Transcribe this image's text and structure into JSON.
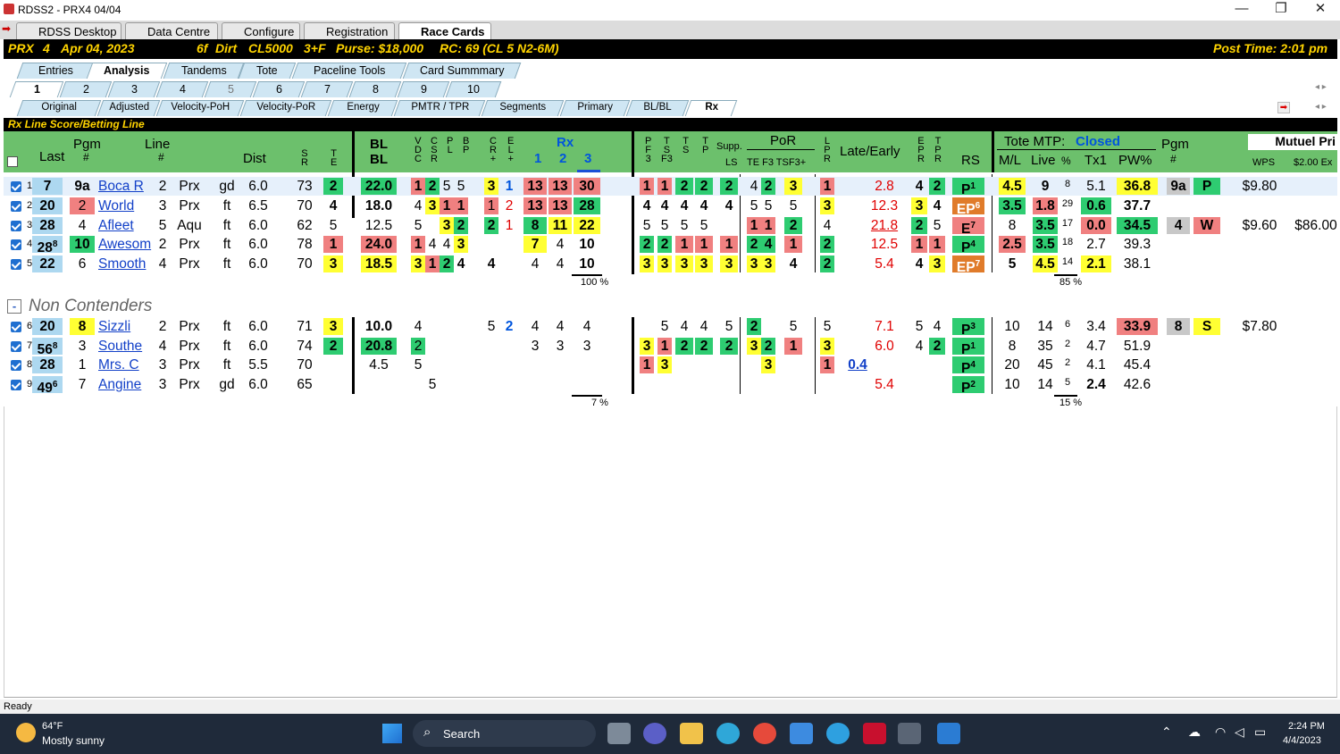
{
  "window": {
    "title": "RDSS2 - PRX4  04/04"
  },
  "app_tabs": [
    "RDSS Desktop",
    "Data Centre",
    "Configure",
    "Registration",
    "Race Cards"
  ],
  "race": {
    "track": "PRX",
    "race": "4",
    "date": "Apr 04, 2023",
    "distance": "6f",
    "surface": "Dirt",
    "class": "CL5000",
    "age": "3+F",
    "purse": "Purse: $18,000",
    "rc": "RC: 69 (CL 5 N2-6M)",
    "post_time": "Post Time: 2:01 pm"
  },
  "view_tabs": [
    "Entries",
    "Analysis",
    "Tandems",
    "Tote",
    "Paceline Tools",
    "Card Summmary"
  ],
  "race_tabs": [
    "1",
    "2",
    "3",
    "4",
    "5",
    "6",
    "7",
    "8",
    "9",
    "10"
  ],
  "sub_tabs": [
    "Original",
    "Adjusted",
    "Velocity-PoH",
    "Velocity-PoR",
    "Energy",
    "PMTR / TPR",
    "Segments",
    "Primary",
    "BL/BL",
    "Rx"
  ],
  "section_title": "Rx Line Score/Betting Line",
  "headers": {
    "last": "Last",
    "pgm": "Pgm",
    "pgm_hash": "#",
    "line": "Line",
    "line_hash": "#",
    "dist": "Dist",
    "sr": [
      "S",
      "R"
    ],
    "te": [
      "T",
      "E"
    ],
    "bl1": "BL",
    "bl2": "BL",
    "vdc": [
      "V",
      "D",
      "C"
    ],
    "csr": [
      "C",
      "S",
      "R"
    ],
    "pl": [
      "P",
      "L"
    ],
    "bp": [
      "B",
      "P"
    ],
    "cr": [
      "C",
      "R",
      "+"
    ],
    "el": [
      "E",
      "L",
      "+"
    ],
    "rx": "Rx",
    "rx_cols": [
      "1",
      "2",
      "3"
    ],
    "pf3": [
      "P",
      "F",
      "3"
    ],
    "tsf3": [
      "T",
      "S",
      "F3"
    ],
    "ts": [
      "T",
      "S"
    ],
    "tp": [
      "T",
      "P"
    ],
    "supp": "Supp.",
    "ls": "LS",
    "por": "PoR",
    "por_cols": "TE F3 TSF3+",
    "lpr": [
      "L",
      "P",
      "R"
    ],
    "late_early": "Late/Early",
    "epr": [
      "E",
      "P",
      "R"
    ],
    "tpr": [
      "T",
      "P",
      "R"
    ],
    "rs": "RS",
    "tote": "Tote MTP:",
    "tote_status": "Closed",
    "ml": "M/L",
    "live": "Live",
    "pct": "%",
    "tx1": "Tx1",
    "pw": "PW%",
    "pgm2": "Pgm",
    "pgm2_hash": "#",
    "mutuel": "Mutuel Pri",
    "wps": "WPS",
    "ex": "$2.00 Ex"
  },
  "contenders": [
    {
      "n": "1",
      "last": "7",
      "pgm": "9a",
      "name": "Boca R",
      "line": "2",
      "trk": "Prx",
      "cond": "gd",
      "dist": "6.0",
      "sr": "73",
      "te": "2",
      "bl": "22.0",
      "vdc": "1",
      "csr": "2",
      "pl": "5",
      "bp": "5",
      "cr": "3",
      "el": "1",
      "rx1": "13",
      "rx2": "13",
      "rx3": "30",
      "p3": "1",
      "tsf3": "1",
      "ts": "2",
      "tp": "2",
      "supp": "2",
      "te2": "4",
      "f3": "2",
      "tsf3p": "3",
      "lpr": "1",
      "late": "2.8",
      "epr": "4",
      "tpr": "2",
      "rs": "P",
      "rs_sup": "1",
      "ml": "4.5",
      "live": "9",
      "pct": "8",
      "tx1": "5.1",
      "pw": "36.8",
      "pgm2": "9a",
      "pos": "P",
      "wps": "$9.80",
      "ex": ""
    },
    {
      "n": "2",
      "last": "20",
      "pgm": "2",
      "name": "World",
      "line": "3",
      "trk": "Prx",
      "cond": "ft",
      "dist": "6.5",
      "sr": "70",
      "te": "4",
      "bl": "18.0",
      "vdc": "4",
      "csr": "3",
      "pl": "1",
      "bp": "1",
      "cr": "1",
      "el": "2",
      "rx1": "13",
      "rx2": "13",
      "rx3": "28",
      "p3": "4",
      "tsf3": "4",
      "ts": "4",
      "tp": "4",
      "supp": "4",
      "te2": "5",
      "f3": "5",
      "tsf3p": "5",
      "lpr": "3",
      "late": "12.3",
      "epr": "3",
      "tpr": "4",
      "rs": "EP",
      "rs_sup": "6",
      "ml": "3.5",
      "live": "1.8",
      "pct": "29",
      "tx1": "0.6",
      "pw": "37.7",
      "pgm2": "",
      "pos": "",
      "wps": "",
      "ex": ""
    },
    {
      "n": "3",
      "last": "28",
      "pgm": "4",
      "name": "Afleet",
      "line": "5",
      "trk": "Aqu",
      "cond": "ft",
      "dist": "6.0",
      "sr": "62",
      "te": "5",
      "bl": "12.5",
      "vdc": "5",
      "csr": "",
      "pl": "3",
      "bp": "2",
      "cr": "2",
      "el": "1",
      "rx1": "8",
      "rx2": "11",
      "rx3": "22",
      "p3": "5",
      "tsf3": "5",
      "ts": "5",
      "tp": "5",
      "supp": "",
      "te2": "1",
      "f3": "1",
      "tsf3p": "2",
      "lpr": "4",
      "late": "21.8",
      "epr": "2",
      "tpr": "5",
      "rs": "E",
      "rs_sup": "7",
      "ml": "8",
      "live": "3.5",
      "pct": "17",
      "tx1": "0.0",
      "pw": "34.5",
      "pgm2": "4",
      "pos": "W",
      "wps": "$9.60",
      "ex": "$86.00"
    },
    {
      "n": "4",
      "last": "28",
      "last_sup": "8",
      "pgm": "10",
      "name": "Awesom",
      "line": "2",
      "trk": "Prx",
      "cond": "ft",
      "dist": "6.0",
      "sr": "78",
      "te": "1",
      "bl": "24.0",
      "vdc": "1",
      "csr": "4",
      "pl": "4",
      "bp": "3",
      "cr": "",
      "el": "",
      "rx1": "7",
      "rx2": "4",
      "rx3": "10",
      "p3": "2",
      "tsf3": "2",
      "ts": "1",
      "tp": "1",
      "supp": "1",
      "te2": "2",
      "f3": "4",
      "tsf3p": "1",
      "lpr": "2",
      "late": "12.5",
      "epr": "1",
      "tpr": "1",
      "rs": "P",
      "rs_sup": "4",
      "ml": "2.5",
      "live": "3.5",
      "pct": "18",
      "tx1": "2.7",
      "pw": "39.3",
      "pgm2": "",
      "pos": "",
      "wps": "",
      "ex": ""
    },
    {
      "n": "5",
      "last": "22",
      "pgm": "6",
      "name": "Smooth",
      "line": "4",
      "trk": "Prx",
      "cond": "ft",
      "dist": "6.0",
      "sr": "70",
      "te": "3",
      "bl": "18.5",
      "vdc": "3",
      "csr": "1",
      "pl": "2",
      "bp": "4",
      "cr": "4",
      "el": "",
      "rx1": "4",
      "rx2": "4",
      "rx3": "10",
      "p3": "3",
      "tsf3": "3",
      "ts": "3",
      "tp": "3",
      "supp": "3",
      "te2": "3",
      "f3": "3",
      "tsf3p": "4",
      "lpr": "2",
      "late": "5.4",
      "epr": "4",
      "tpr": "3",
      "rs": "EP",
      "rs_sup": "7",
      "ml": "5",
      "live": "4.5",
      "pct": "14",
      "tx1": "2.1",
      "pw": "38.1",
      "pgm2": "",
      "pos": "",
      "wps": "",
      "ex": ""
    }
  ],
  "contender_pct": {
    "rx": "100 %",
    "live": "85 %"
  },
  "non_contenders_label": "Non Contenders",
  "non_contenders": [
    {
      "n": "6",
      "last": "20",
      "pgm": "8",
      "name": "Sizzli",
      "line": "2",
      "trk": "Prx",
      "cond": "ft",
      "dist": "6.0",
      "sr": "71",
      "te": "3",
      "bl": "10.0",
      "vdc": "4",
      "cr": "5",
      "el": "2",
      "rx1": "4",
      "rx2": "4",
      "rx3": "4",
      "tsf3": "5",
      "ts": "4",
      "tp": "4",
      "supp": "5",
      "te2": "2",
      "tsf3p": "5",
      "lpr": "5",
      "late": "7.1",
      "epr": "5",
      "tpr": "4",
      "rs": "P",
      "rs_sup": "3",
      "ml": "10",
      "live": "14",
      "pct": "6",
      "tx1": "3.4",
      "pw": "33.9",
      "pgm2": "8",
      "pos": "S",
      "wps": "$7.80"
    },
    {
      "n": "7",
      "last": "56",
      "last_sup": "8",
      "pgm": "3",
      "name": "Southe",
      "line": "4",
      "trk": "Prx",
      "cond": "ft",
      "dist": "6.0",
      "sr": "74",
      "te": "2",
      "bl": "20.8",
      "vdc": "2",
      "rx1": "3",
      "rx2": "3",
      "rx3": "3",
      "p3": "3",
      "tsf3": "1",
      "ts": "2",
      "tp": "2",
      "supp": "2",
      "te2": "3",
      "f3": "2",
      "tsf3p": "1",
      "lpr": "3",
      "late": "6.0",
      "epr": "4",
      "tpr": "2",
      "rs": "P",
      "rs_sup": "1",
      "ml": "8",
      "live": "35",
      "pct": "2",
      "tx1": "4.7",
      "pw": "51.9"
    },
    {
      "n": "8",
      "last": "28",
      "pgm": "1",
      "name": "Mrs. C",
      "line": "3",
      "trk": "Prx",
      "cond": "ft",
      "dist": "5.5",
      "sr": "70",
      "bl": "4.5",
      "vdc": "5",
      "p3": "1",
      "tsf3": "3",
      "f3": "3",
      "lpr": "1",
      "early": "0.4",
      "rs": "P",
      "rs_sup": "4",
      "ml": "20",
      "live": "45",
      "pct": "2",
      "tx1": "4.1",
      "pw": "45.4"
    },
    {
      "n": "9",
      "last": "49",
      "last_sup": "6",
      "pgm": "7",
      "name": "Angine",
      "line": "3",
      "trk": "Prx",
      "cond": "gd",
      "dist": "6.0",
      "sr": "65",
      "csr": "5",
      "late": "5.4",
      "rs": "P",
      "rs_sup": "2",
      "ml": "10",
      "live": "14",
      "pct": "5",
      "tx1": "2.4",
      "pw": "42.6"
    }
  ],
  "noncontender_pct": {
    "rx": "7 %",
    "live": "15 %"
  },
  "status": "Ready",
  "taskbar": {
    "temp": "64°F",
    "weather": "Mostly sunny",
    "search": "Search",
    "time": "2:24 PM",
    "date": "4/4/2023"
  },
  "colors": {
    "green": "#2ecc71",
    "yellow": "#ffff33",
    "red": "#f08080",
    "header_green": "#6cc06c",
    "orange": "#e07b2a"
  }
}
